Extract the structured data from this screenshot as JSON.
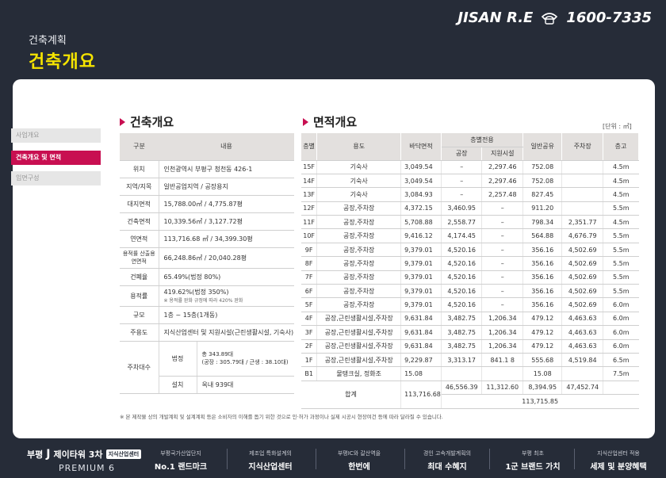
{
  "header": {
    "subtitle": "건축계획",
    "title": "건축개요",
    "brand": "JISAN R.E",
    "phone": "1600-7335"
  },
  "side_tabs": [
    "사업개요",
    "건축개요 및 면적",
    "입면구성"
  ],
  "overview": {
    "title": "건축개요",
    "header_key": "구분",
    "header_value": "내용",
    "rows": [
      {
        "k": "위치",
        "v": "인천광역시 부평구 청천동 426-1"
      },
      {
        "k": "지역/지목",
        "v": "일반공업지역 / 공장용지"
      },
      {
        "k": "대지면적",
        "v": "15,788.00㎡ / 4,775.87평"
      },
      {
        "k": "건축면적",
        "v": "10,339.56㎡ / 3,127.72평"
      },
      {
        "k": "연면적",
        "v": "113,716.68 ㎡ / 34,399.30평"
      },
      {
        "k1": "용적률 산출용",
        "k2": "연면적",
        "v": "66,248.86㎡ / 20,040.28평"
      },
      {
        "k": "건폐율",
        "v": "65.49%(법정 80%)"
      },
      {
        "k": "용적률",
        "v": "419.62%(법정 350%)",
        "v2": "※ 용적률 완화 규정에 따라 420% 완화"
      },
      {
        "k": "규모",
        "v": "1층 ~ 15층(1개동)"
      },
      {
        "k": "주용도",
        "v": "지식산업센터 및 지원시설(근린생활시설, 기숙사)"
      }
    ],
    "parking": {
      "k": "주차대수",
      "legal_k": "법정",
      "legal_v1": "총 343.89대",
      "legal_v2": "(공장 : 305.79대 / 근생 : 38.10대)",
      "inst_k": "설치",
      "inst_v": "옥내 939대"
    }
  },
  "area": {
    "title": "면적개요",
    "unit_note": "[단위 : ㎡]",
    "headers": {
      "floor": "층별",
      "use": "용도",
      "floor_area": "바닥면적",
      "exclusive": "층별전용",
      "factory": "공장",
      "support": "지원시설",
      "common": "일반공유",
      "parking": "주차장",
      "height": "층고"
    },
    "rows": [
      [
        "15F",
        "기숙사",
        "3,049.54",
        "–",
        "2,297.46",
        "752.08",
        "",
        "4.5m"
      ],
      [
        "14F",
        "기숙사",
        "3,049.54",
        "–",
        "2,297.46",
        "752.08",
        "",
        "4.5m"
      ],
      [
        "13F",
        "기숙사",
        "3,084.93",
        "–",
        "2,257.48",
        "827.45",
        "",
        "4.5m"
      ],
      [
        "12F",
        "공장,주차장",
        "4,372.15",
        "3,460.95",
        "–",
        "911.20",
        "",
        "5.5m"
      ],
      [
        "11F",
        "공장,주차장",
        "5,708.88",
        "2,558.77",
        "–",
        "798.34",
        "2,351.77",
        "4.5m"
      ],
      [
        "10F",
        "공장,주차장",
        "9,416.12",
        "4,174.45",
        "–",
        "564.88",
        "4,676.79",
        "5.5m"
      ],
      [
        "9F",
        "공장,주차장",
        "9,379.01",
        "4,520.16",
        "–",
        "356.16",
        "4,502.69",
        "5.5m"
      ],
      [
        "8F",
        "공장,주차장",
        "9,379.01",
        "4,520.16",
        "–",
        "356.16",
        "4,502.69",
        "5.5m"
      ],
      [
        "7F",
        "공장,주차장",
        "9,379.01",
        "4,520.16",
        "–",
        "356.16",
        "4,502.69",
        "5.5m"
      ],
      [
        "6F",
        "공장,주차장",
        "9,379.01",
        "4,520.16",
        "–",
        "356.16",
        "4,502.69",
        "5.5m"
      ],
      [
        "5F",
        "공장,주차장",
        "9,379.01",
        "4,520.16",
        "–",
        "356.16",
        "4,502.69",
        "6.0m"
      ],
      [
        "4F",
        "공장,근린생활시설,주차장",
        "9,631.84",
        "3,482.75",
        "1,206.34",
        "479.12",
        "4,463.63",
        "6.0m"
      ],
      [
        "3F",
        "공장,근린생활시설,주차장",
        "9,631.84",
        "3,482.75",
        "1,206.34",
        "479.12",
        "4,463.63",
        "6.0m"
      ],
      [
        "2F",
        "공장,근린생활시설,주차장",
        "9,631.84",
        "3,482.75",
        "1,206.34",
        "479.12",
        "4,463.63",
        "6.0m"
      ],
      [
        "1F",
        "공장,근린생활시설,주차장",
        "9,229.87",
        "3,313.17",
        "841.1 8",
        "555.68",
        "4,519.84",
        "6.5m"
      ],
      [
        "B1",
        "물탱크실, 정화조",
        "15.08",
        "",
        "",
        "15.08",
        "",
        "7.5m"
      ]
    ],
    "total": {
      "label": "합계",
      "floor_area": "113,716.68",
      "factory": "46,556.39",
      "support": "11,312.60",
      "common": "8,394.95",
      "parking": "47,452.74",
      "grand": "113,715.85"
    }
  },
  "footnote": "※ 본 제작물 상의 개발계획 및 설계계획 등은 소비자의 이해를 돕기 위한 것으로 인·허가 과정이나 실제 시공시 현장여건 등에 따라 달라질 수 있습니다.",
  "footer": {
    "logo_prefix": "부평",
    "logo_name": "제이타워 3차",
    "logo_tag": "지식산업센터",
    "logo_sub": "PREMIUM 6",
    "features": [
      {
        "t": "부평국가산업단지",
        "m": "No.1 랜드마크"
      },
      {
        "t": "제조업 특화설계의",
        "m": "지식산업센터"
      },
      {
        "t": "부평IC와 갈산역을",
        "m": "한번에"
      },
      {
        "t": "경인 고속개발계획의",
        "m": "최대 수혜지"
      },
      {
        "t": "부평 최초",
        "m": "1군 브랜드 가치"
      },
      {
        "t": "지식산업센터 적용",
        "m": "세제 및 분양혜택"
      }
    ]
  },
  "colors": {
    "accent": "#c80f51",
    "title_yellow": "#f5e400",
    "bg_dark": "#262c38",
    "header_cell": "#e3e0de"
  }
}
